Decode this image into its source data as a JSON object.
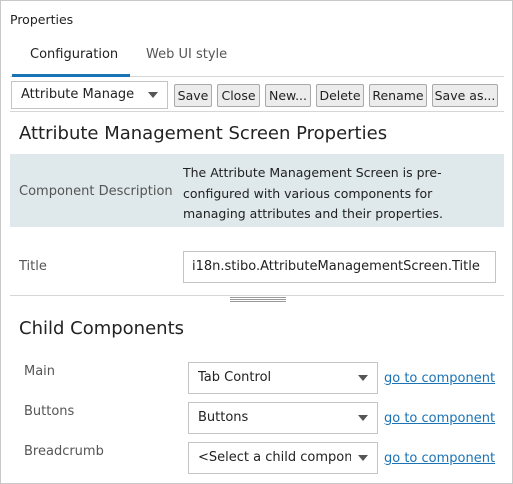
{
  "panel": {
    "title": "Properties"
  },
  "tabs": [
    {
      "label": "Configuration",
      "active": true
    },
    {
      "label": "Web UI style",
      "active": false
    }
  ],
  "toolbar": {
    "selector_value": "Attribute Manage",
    "buttons": [
      "Save",
      "Close",
      "New...",
      "Delete",
      "Rename",
      "Save as..."
    ]
  },
  "screen_properties": {
    "heading": "Attribute Management Screen Properties",
    "description_label": "Component Description",
    "description_text": "The Attribute Management Screen is pre-configured with various components for managing attributes and their properties.",
    "title_label": "Title",
    "title_value": "i18n.stibo.AttributeManagementScreen.Title"
  },
  "child_components": {
    "heading": "Child Components",
    "link_label": "go to component",
    "rows": [
      {
        "label": "Main",
        "value": "Tab Control"
      },
      {
        "label": "Buttons",
        "value": "Buttons"
      },
      {
        "label": "Breadcrumb",
        "value": "<Select a child compone"
      }
    ]
  },
  "colors": {
    "accent": "#1a73b5",
    "description_bg": "#dfe8ea"
  }
}
